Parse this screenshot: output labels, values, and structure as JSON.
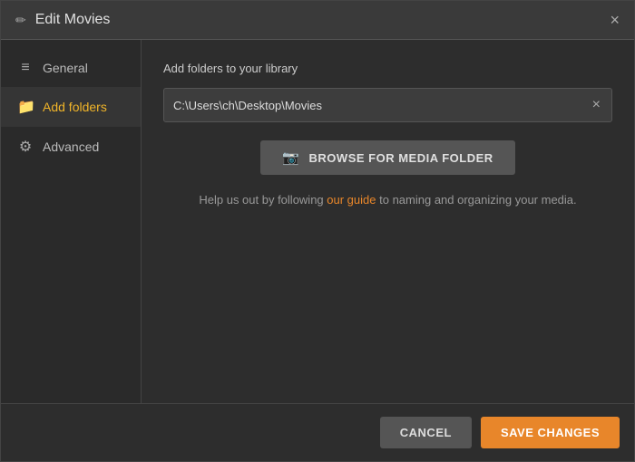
{
  "dialog": {
    "title": "Edit Movies",
    "close_label": "×"
  },
  "sidebar": {
    "items": [
      {
        "id": "general",
        "label": "General",
        "icon": "≡",
        "active": false
      },
      {
        "id": "add-folders",
        "label": "Add folders",
        "icon": "📁",
        "active": true
      },
      {
        "id": "advanced",
        "label": "Advanced",
        "icon": "⚙",
        "active": false
      }
    ]
  },
  "main": {
    "section_label": "Add folders to your library",
    "folder_path": "C:\\Users\\ch\\Desktop\\Movies",
    "browse_button_label": "BROWSE FOR MEDIA FOLDER",
    "help_text_before": "Help us out by following ",
    "help_link_text": "our guide",
    "help_text_after": " to naming and organizing your media."
  },
  "footer": {
    "cancel_label": "CANCEL",
    "save_label": "SAVE CHANGES"
  }
}
